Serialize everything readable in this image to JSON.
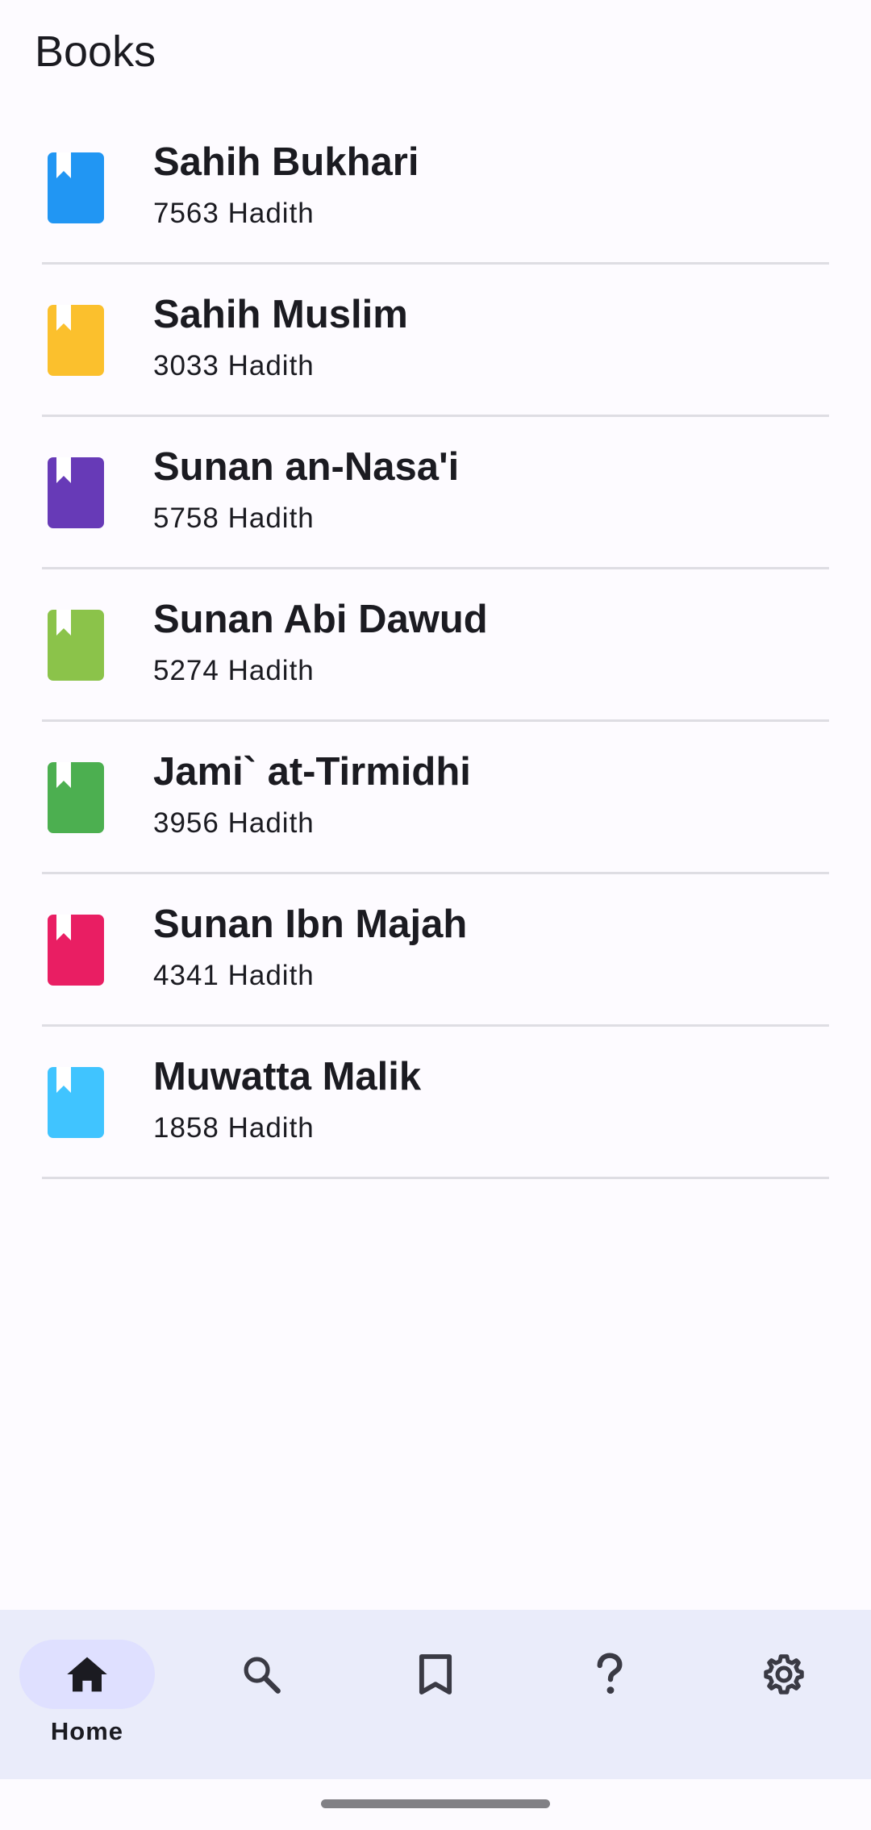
{
  "header": {
    "title": "Books"
  },
  "books": [
    {
      "title": "Sahih Bukhari",
      "count": "7563 Hadith",
      "color": "#2196f3"
    },
    {
      "title": "Sahih Muslim",
      "count": "3033 Hadith",
      "color": "#fbc02d"
    },
    {
      "title": "Sunan an-Nasa'i",
      "count": "5758 Hadith",
      "color": "#673ab7"
    },
    {
      "title": "Sunan Abi Dawud",
      "count": "5274 Hadith",
      "color": "#8bc34a"
    },
    {
      "title": "Jami` at-Tirmidhi",
      "count": "3956 Hadith",
      "color": "#4caf50"
    },
    {
      "title": "Sunan Ibn Majah",
      "count": "4341 Hadith",
      "color": "#e91e63"
    },
    {
      "title": "Muwatta Malik",
      "count": "1858 Hadith",
      "color": "#40c4ff"
    }
  ],
  "nav": {
    "items": [
      {
        "label": "Home",
        "icon": "home-icon",
        "active": true
      },
      {
        "label": "",
        "icon": "search-icon",
        "active": false
      },
      {
        "label": "",
        "icon": "bookmark-icon",
        "active": false
      },
      {
        "label": "",
        "icon": "help-icon",
        "active": false
      },
      {
        "label": "",
        "icon": "settings-icon",
        "active": false
      }
    ]
  },
  "theme": {
    "background": "#fdfbff",
    "nav_background": "#eaecfa",
    "nav_active": "#dfe0ff",
    "text": "#1b1b21"
  }
}
